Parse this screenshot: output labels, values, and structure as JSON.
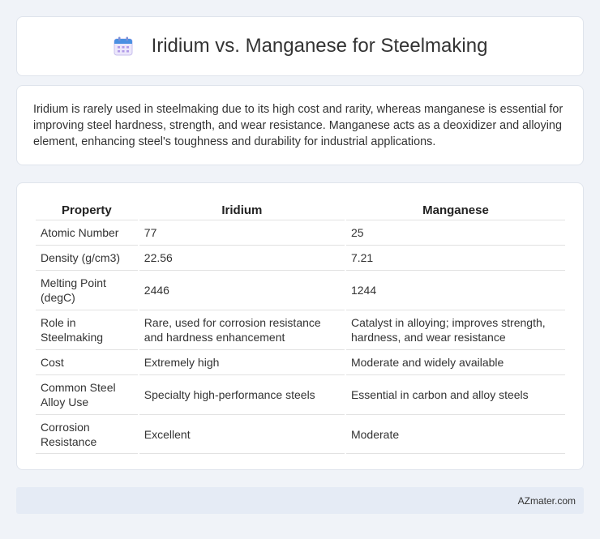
{
  "header": {
    "title": "Iridium vs. Manganese for Steelmaking",
    "icon": "calendar-icon"
  },
  "summary": {
    "text": "Iridium is rarely used in steelmaking due to its high cost and rarity, whereas manganese is essential for improving steel hardness, strength, and wear resistance. Manganese acts as a deoxidizer and alloying element, enhancing steel's toughness and durability for industrial applications."
  },
  "table": {
    "headers": [
      "Property",
      "Iridium",
      "Manganese"
    ],
    "rows": [
      [
        "Atomic Number",
        "77",
        "25"
      ],
      [
        "Density (g/cm3)",
        "22.56",
        "7.21"
      ],
      [
        "Melting Point (degC)",
        "2446",
        "1244"
      ],
      [
        "Role in Steelmaking",
        "Rare, used for corrosion resistance and hardness enhancement",
        "Catalyst in alloying; improves strength, hardness, and wear resistance"
      ],
      [
        "Cost",
        "Extremely high",
        "Moderate and widely available"
      ],
      [
        "Common Steel Alloy Use",
        "Specialty high-performance steels",
        "Essential in carbon and alloy steels"
      ],
      [
        "Corrosion Resistance",
        "Excellent",
        "Moderate"
      ]
    ]
  },
  "footer": {
    "brand": "AZmater.com"
  }
}
